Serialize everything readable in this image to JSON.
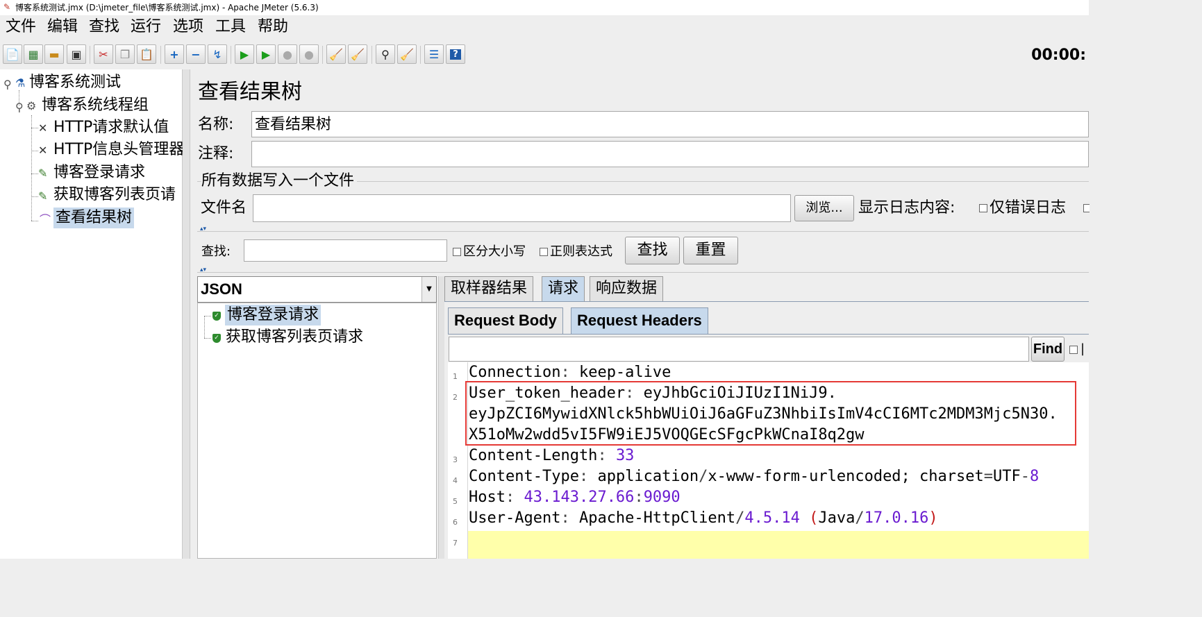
{
  "window": {
    "title": "博客系统测试.jmx (D:\\jmeter_file\\博客系统测试.jmx) - Apache JMeter (5.6.3)"
  },
  "menu": [
    "文件",
    "编辑",
    "查找",
    "运行",
    "选项",
    "工具",
    "帮助"
  ],
  "toolbar": {
    "timer": "00:00:",
    "icons": [
      "new-icon",
      "templates-icon",
      "open-icon",
      "save-icon",
      "cut-icon",
      "copy-icon",
      "paste-icon",
      "expand-icon",
      "collapse-icon",
      "toggle-icon",
      "start-icon",
      "start-no-pause-icon",
      "stop-icon",
      "shutdown-icon",
      "clear-icon",
      "clear-all-icon",
      "search-icon",
      "reset-search-icon",
      "function-helper-icon",
      "help-icon"
    ]
  },
  "tree": {
    "items": [
      {
        "label": "博客系统测试",
        "icon": "testplan-icon"
      },
      {
        "label": "博客系统线程组",
        "icon": "gear-icon"
      },
      {
        "label": "HTTP请求默认值",
        "icon": "config-icon"
      },
      {
        "label": "HTTP信息头管理器",
        "icon": "config-icon"
      },
      {
        "label": "博客登录请求",
        "icon": "sampler-icon"
      },
      {
        "label": "获取博客列表页请",
        "icon": "sampler-icon"
      },
      {
        "label": "查看结果树",
        "icon": "listener-icon"
      }
    ]
  },
  "panel": {
    "title": "查看结果树",
    "name_label": "名称:",
    "name_value": "查看结果树",
    "comment_label": "注释:",
    "comment_value": "",
    "file_section": "所有数据写入一个文件",
    "file_label": "文件名",
    "file_value": "",
    "browse_button": "浏览...",
    "log_label": "显示日志内容:",
    "errors_only": "仅错误日志",
    "search_label": "查找:",
    "search_value": "",
    "case_sensitive": "区分大小写",
    "regex": "正则表达式",
    "find_button": "查找",
    "reset_button": "重置"
  },
  "results": {
    "renderer": "JSON",
    "samples": [
      "博客登录请求",
      "获取博客列表页请求"
    ],
    "tabs": [
      "取样器结果",
      "请求",
      "响应数据"
    ],
    "selected_tab": "请求",
    "subtabs": [
      "Request Body",
      "Request Headers"
    ],
    "selected_subtab": "Request Headers",
    "find_button": "Find",
    "find_value": ""
  },
  "headers": {
    "line_numbers": [
      "1",
      "2",
      "3",
      "4",
      "5",
      "6",
      "7"
    ],
    "connection": {
      "key": "Connection",
      "value": "keep-alive"
    },
    "token": {
      "key": "User_token_header",
      "value_line1": "eyJhbGciOiJIUzI1NiJ9.",
      "value_line2": "eyJpZCI6MywidXNlck5hbWUiOiJ6aGFuZ3NhbiIsImV4cCI6MTc2MDM3Mjc5N30.",
      "value_line3": "X51oMw2wdd5vI5FW9iEJ5VOQGEcSFgcPkWCnaI8q2gw"
    },
    "content_length": {
      "key": "Content-Length",
      "value": "33"
    },
    "content_type": {
      "key": "Content-Type",
      "v1": "application",
      "v2": "x-www-form-urlencoded; charset",
      "v3": "UTF",
      "v4": "8"
    },
    "host": {
      "key": "Host",
      "v1": "43.143.27.66",
      "v2": "9090"
    },
    "user_agent": {
      "key": "User-Agent",
      "v1": "Apache-HttpClient",
      "v2": "4.5.14",
      "v3": "Java",
      "v4": "17.0.16"
    },
    "highlight_color": "#e53935",
    "current_line_color": "#ffffaa"
  }
}
